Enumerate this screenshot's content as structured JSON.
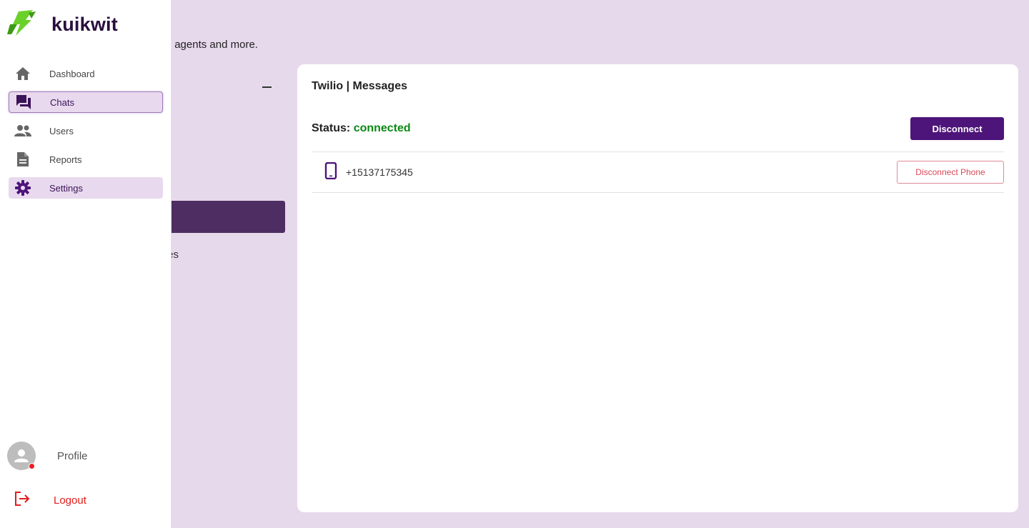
{
  "background": {
    "subtitle": "ers, managers, agents and more.",
    "partial_label": "es"
  },
  "brand": {
    "name": "kuikwit",
    "logo_icon": "lightning-bolt-icon"
  },
  "sidebar": {
    "items": [
      {
        "label": "Dashboard",
        "icon": "home-icon",
        "state": "normal"
      },
      {
        "label": "Chats",
        "icon": "chat-icon",
        "state": "active"
      },
      {
        "label": "Users",
        "icon": "users-icon",
        "state": "normal"
      },
      {
        "label": "Reports",
        "icon": "document-icon",
        "state": "normal"
      },
      {
        "label": "Settings",
        "icon": "gear-icon",
        "state": "selected"
      }
    ],
    "profile_label": "Profile",
    "logout_label": "Logout"
  },
  "card": {
    "title": "Twilio | Messages",
    "status_label": "Status:",
    "status_value": "connected",
    "disconnect_label": "Disconnect",
    "phone": {
      "number": "+15137175345",
      "disconnect_label": "Disconnect Phone"
    }
  },
  "colors": {
    "accent": "#4d1479",
    "status_connected": "#0a8a14",
    "danger": "#e21b1b",
    "page_bg": "#e7d9ec"
  }
}
